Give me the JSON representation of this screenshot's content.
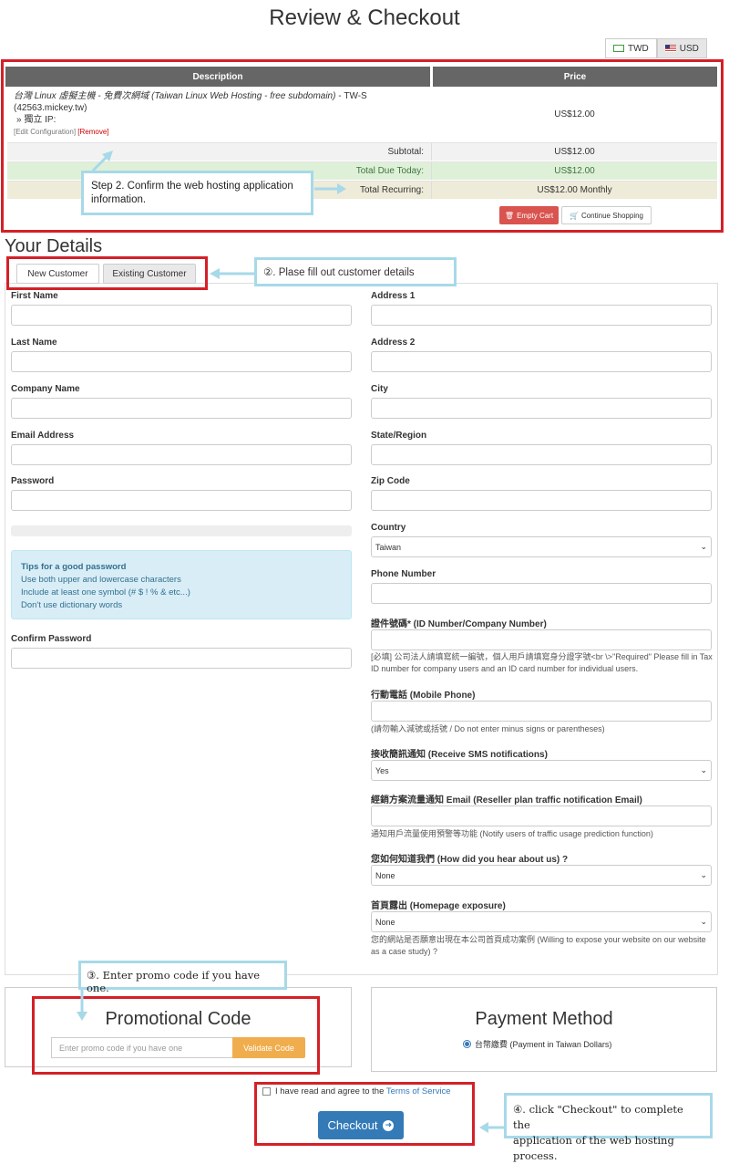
{
  "page_title": "Review & Checkout",
  "currency": {
    "twd": "TWD",
    "usd": "USD",
    "active": "USD"
  },
  "cart": {
    "col_description": "Description",
    "col_price": "Price",
    "item_name": "台灣 Linux 虛擬主機 - 免費次網域 (Taiwan Linux Web Hosting - free subdomain)",
    "item_suffix": " - TW-S",
    "item_domain": "(42563.mickey.tw)",
    "item_ip": "» 獨立 IP:",
    "edit_config": "[Edit Configuration]",
    "remove": "[Remove]",
    "item_price": "US$12.00",
    "subtotal_label": "Subtotal:",
    "subtotal_value": "US$12.00",
    "due_label": "Total Due Today:",
    "due_value": "US$12.00",
    "recurring_label": "Total Recurring:",
    "recurring_value": "US$12.00 Monthly",
    "empty_cart": "Empty Cart",
    "continue_shopping": "Continue Shopping"
  },
  "annotations": {
    "step2": "Step 2. Confirm the web hosting application information.",
    "step2_line1": "Step 2. Confirm the web hosting application",
    "step2_line2": "information.",
    "step3": "②. Plase fill out customer details",
    "step4": "③. Enter promo code if you have one.",
    "step5_line1": "④. click \"Checkout\" to complete the",
    "step5_line2": "application of the web hosting process."
  },
  "details": {
    "heading": "Your Details",
    "tab_new": "New Customer",
    "tab_existing": "Existing Customer",
    "left": {
      "first_name": "First Name",
      "last_name": "Last Name",
      "company": "Company Name",
      "email": "Email Address",
      "password": "Password",
      "confirm_password": "Confirm Password",
      "tips_title": "Tips for a good password",
      "tip1": "Use both upper and lowercase characters",
      "tip2": "Include at least one symbol (# $ ! % & etc...)",
      "tip3": "Don't use dictionary words"
    },
    "right": {
      "address1": "Address 1",
      "address2": "Address 2",
      "city": "City",
      "state": "State/Region",
      "zip": "Zip Code",
      "country": "Country",
      "country_value": "Taiwan",
      "phone": "Phone Number",
      "id_label": "證件號碼* (ID Number/Company Number)",
      "id_help": "[必填] 公司法人請填寫統一編號，個人用戶請填寫身分證字號<br \\>\"Required\" Please fill in Tax ID number for company users and an ID card number for individual users.",
      "mobile_label": "行動電話 (Mobile Phone)",
      "mobile_help": "(請勿輸入減號或括號 / Do not enter minus signs or parentheses)",
      "sms_label": "接收簡訊通知 (Receive SMS notifications)",
      "sms_value": "Yes",
      "reseller_label": "經銷方案流量通知 Email (Reseller plan traffic notification Email)",
      "reseller_help": "通知用戶流量使用預警等功能 (Notify users of traffic usage prediction function)",
      "hear_label": "您如何知道我們 (How did you hear about us) ?",
      "hear_value": "None",
      "exposure_label": "首頁露出 (Homepage exposure)",
      "exposure_value": "None",
      "exposure_help": "您的網站是否願意出現在本公司首頁成功案例 (Willing to expose your website on our website as a case study) ?"
    }
  },
  "promo": {
    "title": "Promotional Code",
    "placeholder": "Enter promo code if you have one",
    "button": "Validate Code"
  },
  "payment": {
    "title": "Payment Method",
    "option": "台幣繳費 (Payment in Taiwan Dollars)"
  },
  "tos": {
    "text": "I have read and agree to the ",
    "link": "Terms of Service"
  },
  "checkout": "Checkout",
  "colors": {
    "annotation_red": "#d42027",
    "annotation_blue": "#a7d9e8",
    "checkout_blue": "#337ab7",
    "promo_orange": "#f0ad4e",
    "danger": "#d9534f"
  }
}
